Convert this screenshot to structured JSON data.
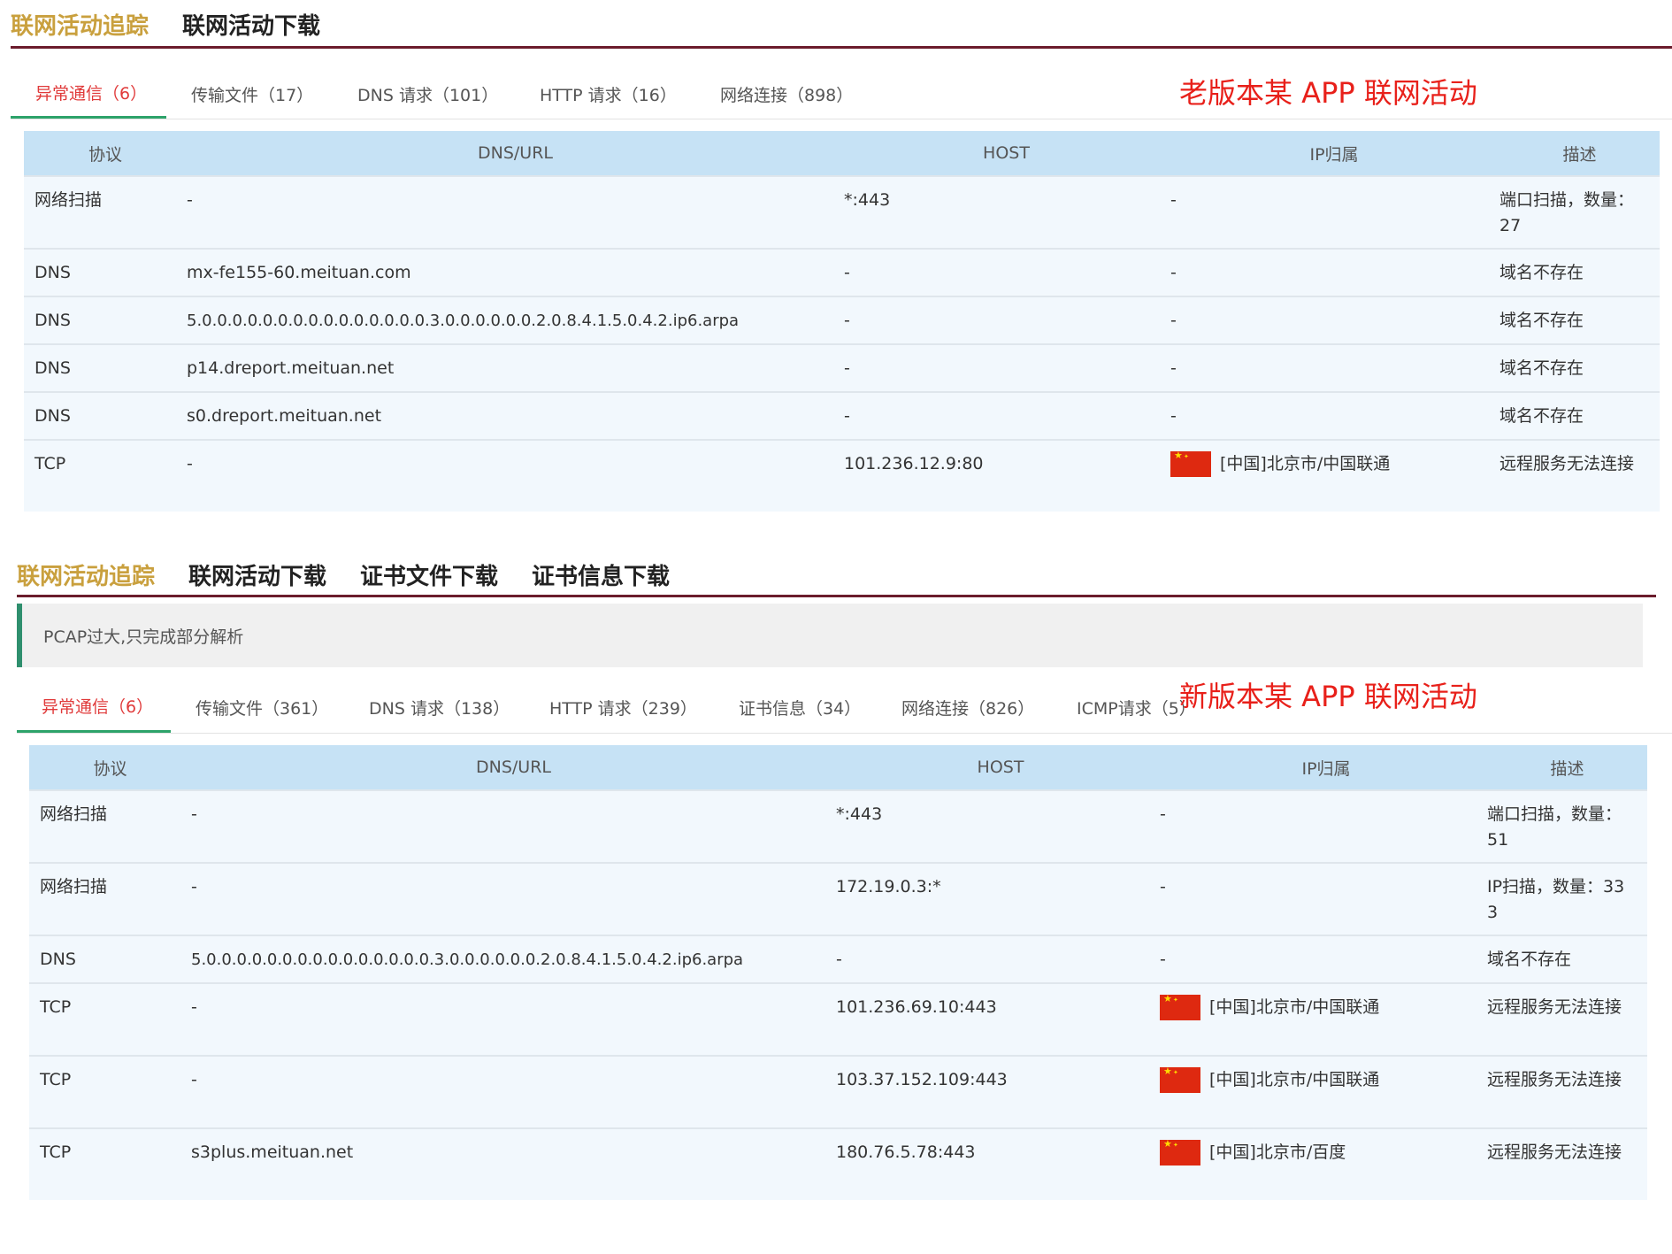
{
  "old": {
    "nav": [
      "联网活动追踪",
      "联网活动下载"
    ],
    "subtabs": [
      "异常通信（6）",
      "传输文件（17）",
      "DNS 请求（101）",
      "HTTP 请求（16）",
      "网络连接（898）"
    ],
    "annotation": "老版本某 APP 联网活动",
    "headers": [
      "协议",
      "DNS/URL",
      "HOST",
      "IP归属",
      "描述"
    ],
    "rows": [
      {
        "proto": "网络扫描",
        "url": "-",
        "host": "*:443",
        "ip": "-",
        "desc": "端口扫描，数量：27"
      },
      {
        "proto": "DNS",
        "url": "mx-fe155-60.meituan.com",
        "host": "-",
        "ip": "-",
        "desc": "域名不存在"
      },
      {
        "proto": "DNS",
        "url": "5.0.0.0.0.0.0.0.0.0.0.0.0.0.0.0.3.0.0.0.0.0.0.2.0.8.4.1.5.0.4.2.ip6.arpa",
        "host": "-",
        "ip": "-",
        "desc": "域名不存在"
      },
      {
        "proto": "DNS",
        "url": "p14.dreport.meituan.net",
        "host": "-",
        "ip": "-",
        "desc": "域名不存在"
      },
      {
        "proto": "DNS",
        "url": "s0.dreport.meituan.net",
        "host": "-",
        "ip": "-",
        "desc": "域名不存在"
      },
      {
        "proto": "TCP",
        "url": "-",
        "host": "101.236.12.9:80",
        "ip": "[中国]北京市/中国联通",
        "desc": "远程服务无法连接"
      }
    ]
  },
  "new": {
    "nav": [
      "联网活动追踪",
      "联网活动下载",
      "证书文件下载",
      "证书信息下载"
    ],
    "notice": "PCAP过大,只完成部分解析",
    "subtabs": [
      "异常通信（6）",
      "传输文件（361）",
      "DNS 请求（138）",
      "HTTP 请求（239）",
      "证书信息（34）",
      "网络连接（826）",
      "ICMP请求（5）"
    ],
    "annotation": "新版本某 APP 联网活动",
    "headers": [
      "协议",
      "DNS/URL",
      "HOST",
      "IP归属",
      "描述"
    ],
    "rows": [
      {
        "proto": "网络扫描",
        "url": "-",
        "host": "*:443",
        "ip": "-",
        "desc": "端口扫描，数量：51"
      },
      {
        "proto": "网络扫描",
        "url": "-",
        "host": "172.19.0.3:*",
        "ip": "-",
        "desc": "IP扫描，数量：333"
      },
      {
        "proto": "DNS",
        "url": "5.0.0.0.0.0.0.0.0.0.0.0.0.0.0.0.3.0.0.0.0.0.0.2.0.8.4.1.5.0.4.2.ip6.arpa",
        "host": "-",
        "ip": "-",
        "desc": "域名不存在"
      },
      {
        "proto": "TCP",
        "url": "-",
        "host": "101.236.69.10:443",
        "ip": "[中国]北京市/中国联通",
        "desc": "远程服务无法连接"
      },
      {
        "proto": "TCP",
        "url": "-",
        "host": "103.37.152.109:443",
        "ip": "[中国]北京市/中国联通",
        "desc": "远程服务无法连接"
      },
      {
        "proto": "TCP",
        "url": "s3plus.meituan.net",
        "host": "180.76.5.78:443",
        "ip": "[中国]北京市/百度",
        "desc": "远程服务无法连接"
      }
    ]
  },
  "colors": {
    "accent": "#c9a03e",
    "active_subtab": "#e03a3a",
    "annotation": "#e8201a",
    "header_bg": "#c6e2f5",
    "nav_line": "#6b1c2c"
  },
  "icons": {
    "flag": "china-flag-icon"
  }
}
